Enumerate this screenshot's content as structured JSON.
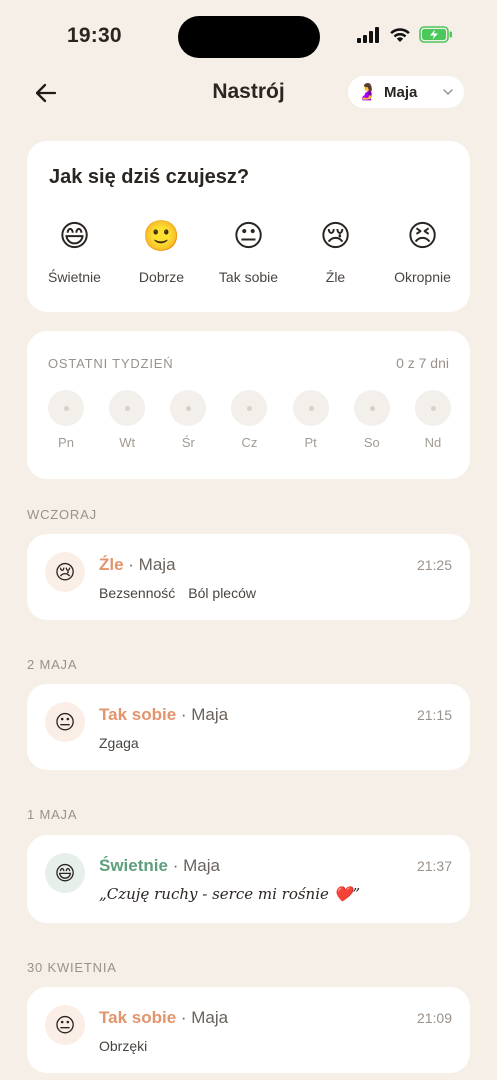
{
  "status": {
    "time": "19:30"
  },
  "header": {
    "title": "Nastrój",
    "user_avatar": "🤰",
    "user_name": "Maja"
  },
  "mood_picker": {
    "question": "Jak się dziś czujesz?",
    "options": [
      {
        "emoji": "😄",
        "label": "Świetnie"
      },
      {
        "emoji": "🙂",
        "label": "Dobrze"
      },
      {
        "emoji": "😐",
        "label": "Tak sobie"
      },
      {
        "emoji": "😢",
        "label": "Źle"
      },
      {
        "emoji": "😣",
        "label": "Okropnie"
      }
    ]
  },
  "week": {
    "title": "OSTATNI TYDZIEŃ",
    "count": "0 z 7 dni",
    "days": [
      "Pn",
      "Wt",
      "Śr",
      "Cz",
      "Pt",
      "So",
      "Nd"
    ]
  },
  "sections": [
    {
      "label": "WCZORAJ",
      "entry": {
        "emoji": "😢",
        "mood": "Źle",
        "separator": " · ",
        "user": "Maja",
        "time": "21:25",
        "tags": [
          "Bezsenność",
          "Ból pleców"
        ]
      }
    },
    {
      "label": "2 MAJA",
      "entry": {
        "emoji": "😐",
        "mood": "Tak sobie",
        "separator": " · ",
        "user": "Maja",
        "time": "21:15",
        "tags": [
          "Zgaga"
        ]
      }
    },
    {
      "label": "1 MAJA",
      "entry": {
        "emoji": "😄",
        "mood": "Świetnie",
        "separator": " · ",
        "user": "Maja",
        "time": "21:37",
        "note": "„Czuję ruchy - serce mi rośnie ❤️”"
      }
    },
    {
      "label": "30 KWIETNIA",
      "entry": {
        "emoji": "😐",
        "mood": "Tak sobie",
        "separator": " · ",
        "user": "Maja",
        "time": "21:09",
        "tags": [
          "Obrzęki"
        ]
      }
    }
  ],
  "colors": {
    "background": "#f5efe8",
    "mood_orange": "#e2946b",
    "mood_green": "#5e9f7c"
  }
}
